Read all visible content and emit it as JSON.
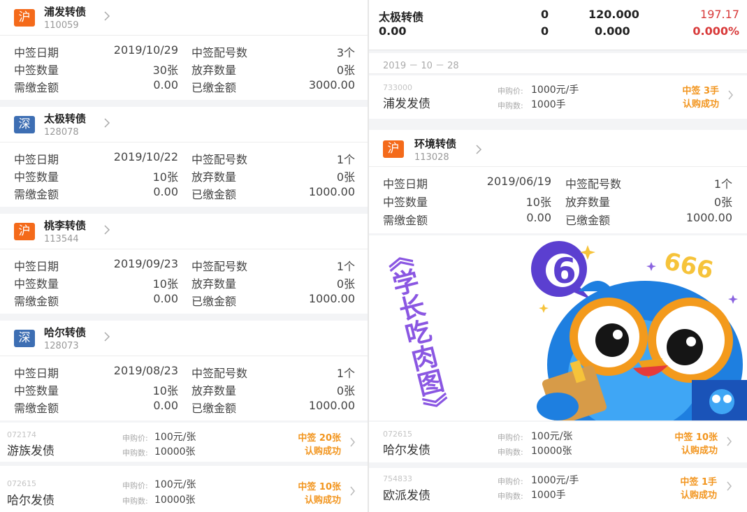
{
  "labels": {
    "date": "中签日期",
    "match_count": "中签配号数",
    "quantity": "中签数量",
    "abandon": "放弃数量",
    "due": "需缴金额",
    "paid": "已缴金额",
    "sub_price": "申购价:",
    "sub_qty": "申购数:"
  },
  "left_cards": [
    {
      "market": "沪",
      "name": "浦发转债",
      "code": "110059",
      "date": "2019/10/29",
      "match_count": "3个",
      "quantity": "30张",
      "abandon": "0张",
      "due": "0.00",
      "paid": "3000.00"
    },
    {
      "market": "深",
      "name": "太极转债",
      "code": "128078",
      "date": "2019/10/22",
      "match_count": "1个",
      "quantity": "10张",
      "abandon": "0张",
      "due": "0.00",
      "paid": "1000.00"
    },
    {
      "market": "沪",
      "name": "桃李转债",
      "code": "113544",
      "date": "2019/09/23",
      "match_count": "1个",
      "quantity": "10张",
      "abandon": "0张",
      "due": "0.00",
      "paid": "1000.00"
    },
    {
      "market": "深",
      "name": "哈尔转债",
      "code": "128073",
      "date": "2019/08/23",
      "match_count": "1个",
      "quantity": "10张",
      "abandon": "0张",
      "due": "0.00",
      "paid": "1000.00"
    }
  ],
  "left_subs": [
    {
      "code": "072174",
      "name": "游族发债",
      "price": "100元/张",
      "qty": "10000张",
      "result": "中签 20张",
      "status": "认购成功"
    },
    {
      "code": "072615",
      "name": "哈尔发债",
      "price": "100元/张",
      "qty": "10000张",
      "result": "中签 10张",
      "status": "认购成功"
    }
  ],
  "right_header": {
    "r1": [
      "太极转债",
      "0",
      "120.000",
      "197.17"
    ],
    "r2": [
      "0.00",
      "0",
      "0.000",
      "0.000%"
    ]
  },
  "right_date": "2019 － 10 － 28",
  "right_sub_top": {
    "code": "733000",
    "name": "浦发发债",
    "price": "1000元/手",
    "qty": "1000手",
    "result": "中签 3手",
    "status": "认购成功"
  },
  "right_card": {
    "market": "沪",
    "name": "环境转债",
    "code": "113028",
    "date": "2019/06/19",
    "match_count": "1个",
    "quantity": "10张",
    "abandon": "0张",
    "due": "0.00",
    "paid": "1000.00"
  },
  "sticker": {
    "caption": "《学长吃肉图》",
    "badge": "6",
    "number": "666"
  },
  "right_subs": [
    {
      "code": "072615",
      "name": "哈尔发债",
      "price": "100元/张",
      "qty": "10000张",
      "result": "中签 10张",
      "status": "认购成功"
    },
    {
      "code": "754833",
      "name": "欧派发债",
      "price": "1000元/手",
      "qty": "1000手",
      "result": "中签 1手",
      "status": "认购成功"
    }
  ],
  "colors": {
    "hu": "#f46a1a",
    "shen": "#3d6eb3",
    "accent": "#f2951e",
    "red": "#d83a3a"
  }
}
